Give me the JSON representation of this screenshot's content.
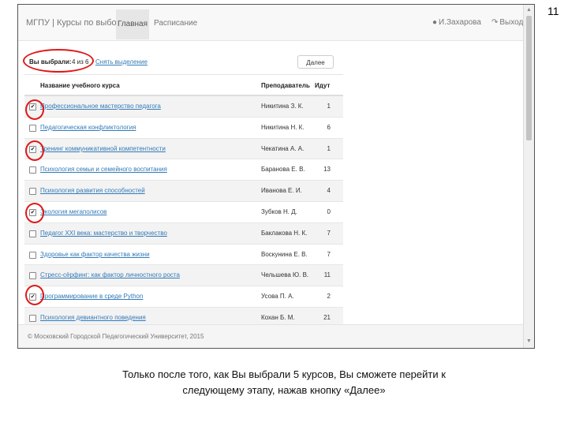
{
  "slide_number": "11",
  "navbar": {
    "brand": "МГПУ | Курсы по выбору",
    "home": "Главная",
    "schedule": "Расписание",
    "user": "И.Захарова",
    "logout": "Выход",
    "user_icon": "user-icon",
    "logout_icon": "logout-icon"
  },
  "selection": {
    "label": "Вы выбрали:",
    "count": "4 из 6",
    "clear_link": "Снять выделение",
    "next_button": "Далее"
  },
  "table": {
    "headers": {
      "course": "Название учебного курса",
      "teacher": "Преподаватель",
      "count": "Идут"
    },
    "rows": [
      {
        "checked": true,
        "course": "Профессиональное мастерство педагога",
        "teacher": "Никитина З. К.",
        "count": "1"
      },
      {
        "checked": false,
        "course": "Педагогическая конфликтология",
        "teacher": "Никитина Н. К.",
        "count": "6"
      },
      {
        "checked": true,
        "course": "Тренинг коммуникативной компетентности",
        "teacher": "Чекатина А. А.",
        "count": "1"
      },
      {
        "checked": false,
        "course": "Психология семьи и семейного воспитания",
        "teacher": "Баранова Е. В.",
        "count": "13"
      },
      {
        "checked": false,
        "course": "Психология развития способностей",
        "teacher": "Иванова Е. И.",
        "count": "4"
      },
      {
        "checked": true,
        "course": "Экология мегаполисов",
        "teacher": "Зубков Н. Д.",
        "count": "0"
      },
      {
        "checked": false,
        "course": "Педагог XXI века: мастерство и творчество",
        "teacher": "Баклакова Н. К.",
        "count": "7"
      },
      {
        "checked": false,
        "course": "Здоровье как фактор качества жизни",
        "teacher": "Воскунина Е. В.",
        "count": "7"
      },
      {
        "checked": false,
        "course": "Стресс-сёрфинг: как фактор личностного роста",
        "teacher": "Чельшева Ю. В.",
        "count": "11"
      },
      {
        "checked": true,
        "course": "Программирование в среде Python",
        "teacher": "Усова П. А.",
        "count": "2"
      },
      {
        "checked": false,
        "course": "Психология девиантного поведения",
        "teacher": "Кохан Б. М.",
        "count": "21"
      }
    ]
  },
  "footer": {
    "text": "© Московский Городской Педагогический Университет, 2015"
  },
  "caption": {
    "line1": "Только после того, как Вы выбрали 5 курсов, Вы сможете перейти к",
    "line2": "следующему этапу, нажав кнопку «Далее»"
  },
  "colors": {
    "annotation": "#e01818",
    "link": "#337ab7"
  }
}
